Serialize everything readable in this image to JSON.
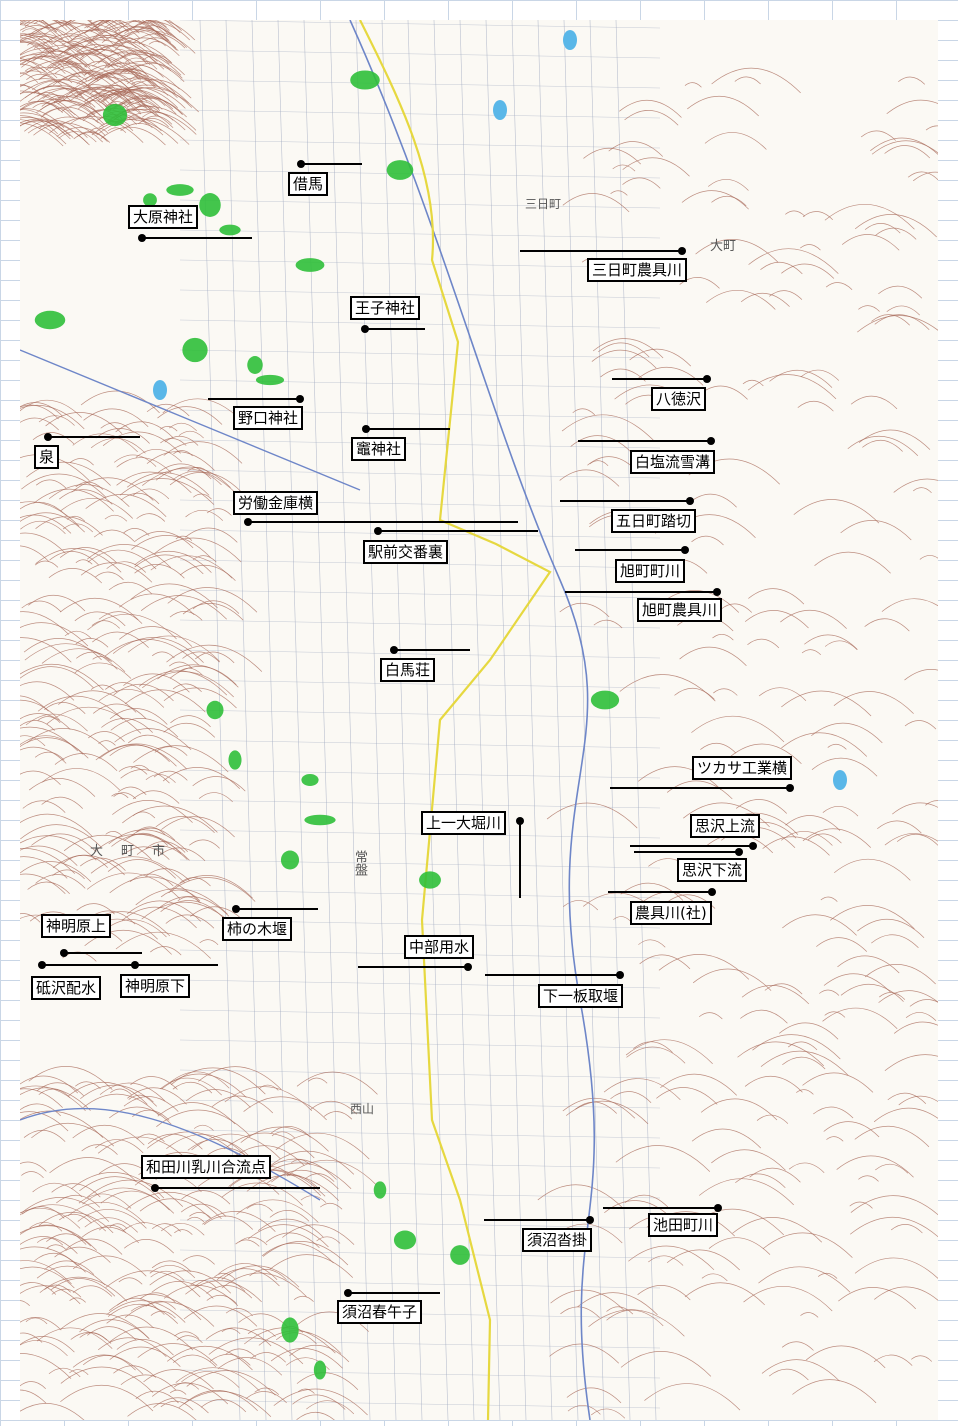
{
  "colors": {
    "contour": "#a86a5a",
    "grid": "#9fa9c0",
    "road": "#e6d840",
    "river": "#6e86c8",
    "field": "#2fbf3a",
    "pond": "#5ab7e8"
  },
  "map_words": [
    "三日町",
    "大町",
    "常盤",
    "西山",
    "大町市"
  ],
  "labels": [
    "借馬",
    "大原神社",
    "三日町農具川",
    "王子神社",
    "八徳沢",
    "野口神社",
    "泉",
    "竈神社",
    "白塩流雪溝",
    "労働金庫横",
    "五日町踏切",
    "駅前交番裏",
    "旭町町川",
    "旭町農具川",
    "白馬荘",
    "ツカサ工業横",
    "上一大堀川",
    "思沢上流",
    "思沢下流",
    "農具川(社)",
    "柿の木堰",
    "神明原上",
    "中部用水",
    "下一板取堰",
    "砥沢配水",
    "神明原下",
    "和田川乳川合流点",
    "須沼沓掛",
    "池田町川",
    "須沼春午子"
  ]
}
